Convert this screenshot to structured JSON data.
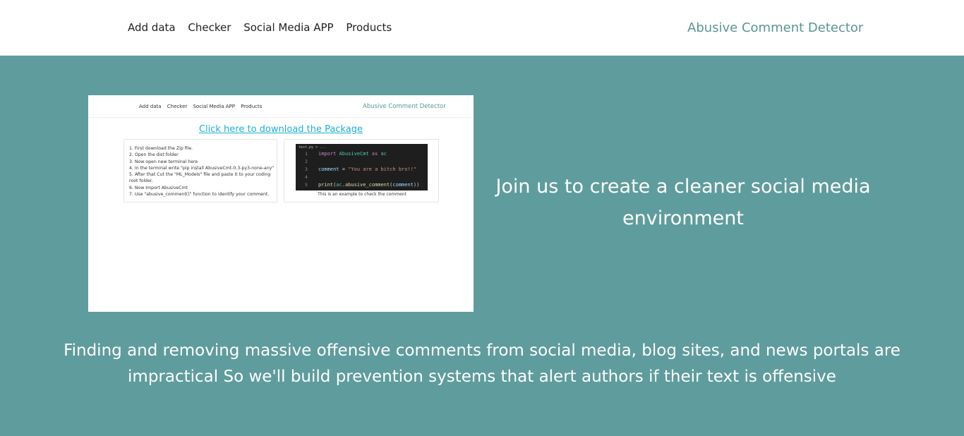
{
  "nav": {
    "links": [
      "Add data",
      "Checker",
      "Social Media APP",
      "Products"
    ],
    "brand": "Abusive Comment Detector"
  },
  "preview": {
    "nav_links": [
      "Add data",
      "Checker",
      "Social Media APP",
      "Products"
    ],
    "brand": "Abusive Comment Detector",
    "download_link": "Click here to download the Package",
    "steps": [
      "1. First download the Zip file.",
      "2. Open the dist folder",
      "3. Now open new terminal here",
      "4. In the terminal write \"pip install AbusiveCmt-0.3-py3-none-any\"",
      "5. After that Cut the \"ML_Models\" file and paste it to your coding root folder.",
      "6. Now Import AbusiveCmt",
      "7. Use \"abusive_comment()\" function to identify your comment."
    ],
    "code": {
      "filename": "test.py > ...",
      "line_numbers": [
        "1",
        "2",
        "3",
        "4",
        "5"
      ],
      "line1": {
        "kw": "import",
        "module": "AbusiveCmt",
        "as": "as",
        "alias": "ac"
      },
      "line3": {
        "var": "comment",
        "eq": "=",
        "str": "\"You are a bitch bro!!\""
      },
      "line5": {
        "fn": "print",
        "open": "(",
        "obj": "ac",
        "dot": ".",
        "method": "abusive_comment",
        "open2": "(",
        "arg": "comment",
        "close": "))"
      }
    },
    "caption": "This is an example to check the comment"
  },
  "hero": {
    "tagline": "Join us to create a cleaner social media environment",
    "description": "Finding and removing massive offensive comments from social media, blog sites, and news portals are impractical So we'll build prevention systems that alert authors if their text is offensive"
  },
  "colors": {
    "hero_bg": "#5f9c9d",
    "brand": "#5a9596",
    "link": "#1ab0d6"
  }
}
